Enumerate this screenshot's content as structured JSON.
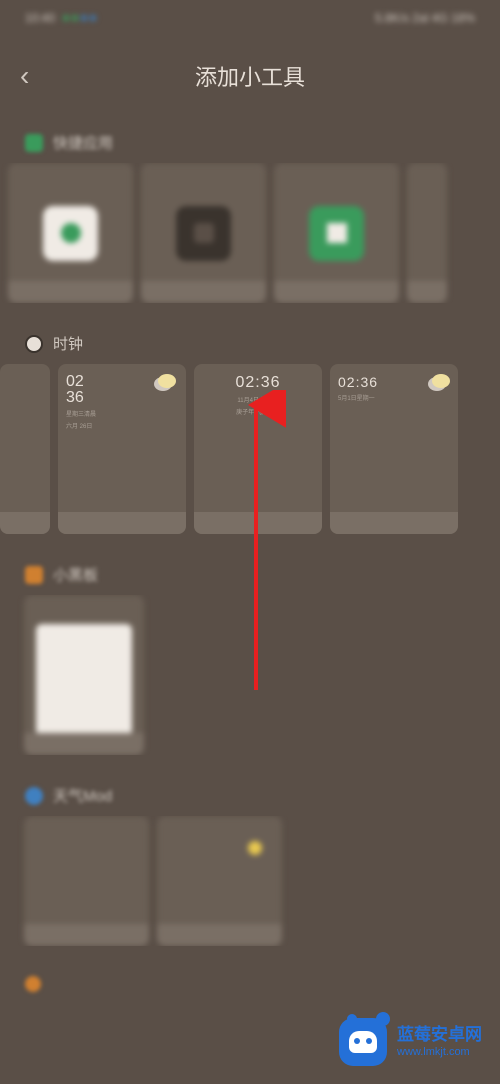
{
  "statusBar": {
    "time": "10:40",
    "right": "5.8K/s 2al 4G 18%"
  },
  "header": {
    "backIcon": "‹",
    "title": "添加小工具"
  },
  "sections": {
    "quick": {
      "title": "快捷应用"
    },
    "clock": {
      "title": "时钟",
      "widgets": [
        {
          "time1": "02",
          "time2": "36",
          "date": "星期三清晨",
          "date2": "六月 26日"
        },
        {
          "time": "02:36",
          "date": "11月4日 星期三",
          "date2": "庚子年 九月十九"
        },
        {
          "time": "02:36",
          "date": "5月1日星期一"
        }
      ]
    },
    "calendar": {
      "title": "小黑板"
    },
    "weather": {
      "title": "天气Mod"
    },
    "more": {
      "title": ""
    }
  },
  "watermark": {
    "name": "蓝莓安卓网",
    "url": "www.lmkjt.com"
  }
}
